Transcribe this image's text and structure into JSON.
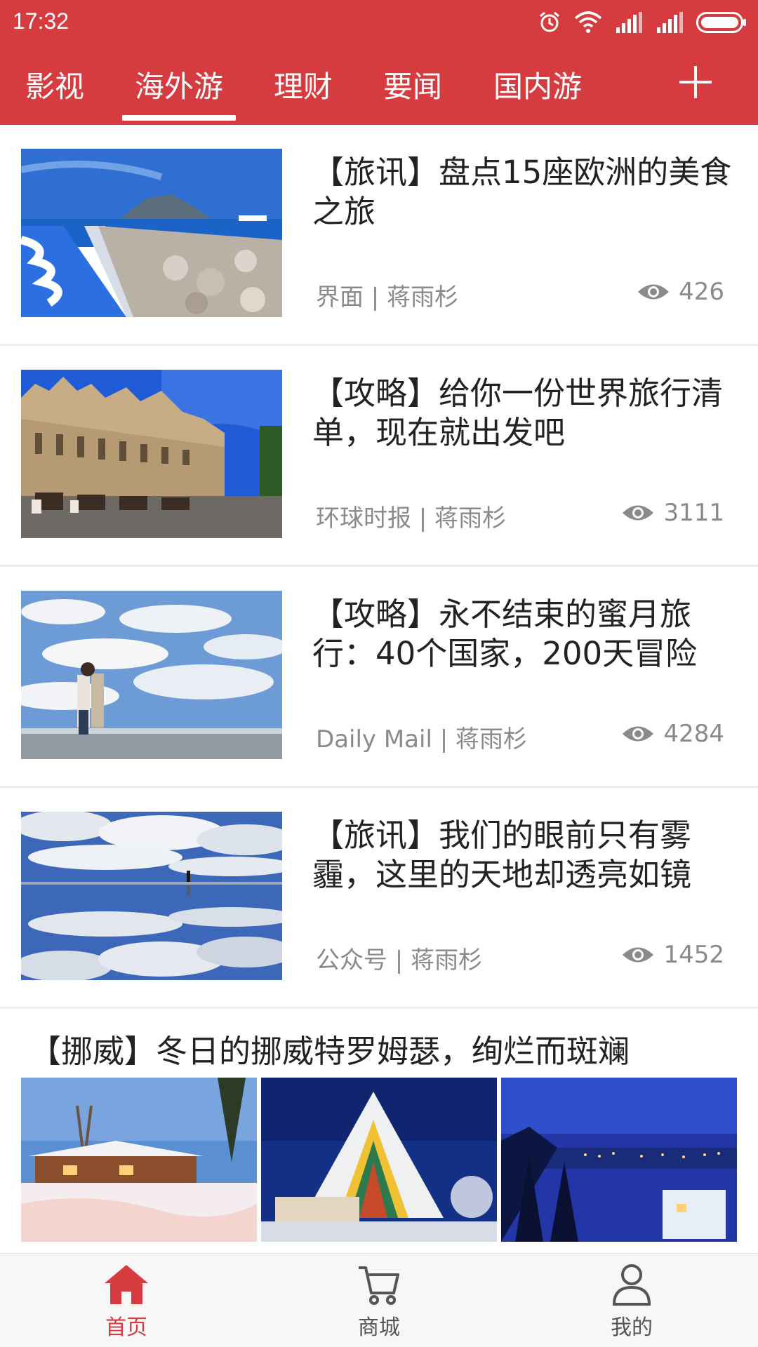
{
  "status": {
    "time": "17:32"
  },
  "tabs": [
    {
      "label": "影视"
    },
    {
      "label": "海外游",
      "active": true
    },
    {
      "label": "理财"
    },
    {
      "label": "要闻"
    },
    {
      "label": "国内游"
    }
  ],
  "articles": [
    {
      "title": "【旅讯】盘点15座欧洲的美食之旅",
      "source": "界面 | 蒋雨杉",
      "views": "426",
      "image": "harbor-breakwater"
    },
    {
      "title": "【攻略】给你一份世界旅行清单，现在就出发吧",
      "source": "环球时报 | 蒋雨杉",
      "views": "3111",
      "image": "gothic-palace-carriages"
    },
    {
      "title": "【攻略】永不结束的蜜月旅行：40个国家，200天冒险",
      "source": "Daily Mail | 蒋雨杉",
      "views": "4284",
      "image": "couple-beach-clouds"
    },
    {
      "title": "【旅讯】我们的眼前只有雾霾，这里的天地却透亮如镜",
      "source": "公众号 | 蒋雨杉",
      "views": "1452",
      "image": "salt-flat-reflection"
    }
  ],
  "gallery_post": {
    "title": "【挪威】冬日的挪威特罗姆瑟，绚烂而斑斓",
    "images": [
      "snowy-cabin",
      "arctic-cathedral",
      "night-city"
    ]
  },
  "bottom_nav": [
    {
      "label": "首页",
      "icon": "home-icon",
      "active": true
    },
    {
      "label": "商城",
      "icon": "cart-icon"
    },
    {
      "label": "我的",
      "icon": "user-icon"
    }
  ],
  "colors": {
    "accent": "#d63b3f",
    "text": "#222222",
    "muted": "#8a8a8a",
    "nav_inactive": "#555555"
  }
}
